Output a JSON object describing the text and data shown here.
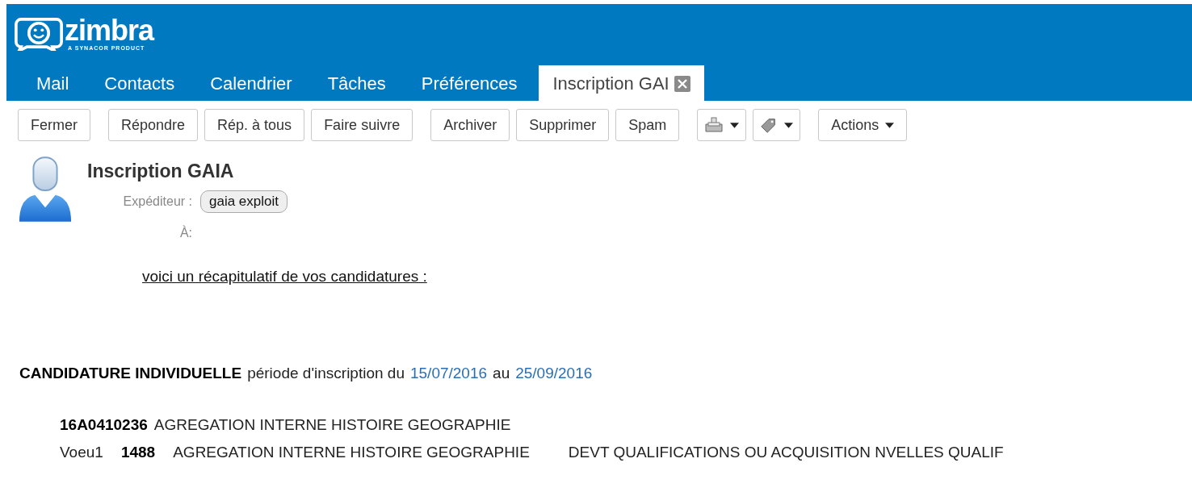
{
  "logo": {
    "name": "zimbra",
    "tagline": "A SYNACOR PRODUCT"
  },
  "tabs": [
    {
      "label": "Mail",
      "selected": false,
      "closable": false
    },
    {
      "label": "Contacts",
      "selected": false,
      "closable": false
    },
    {
      "label": "Calendrier",
      "selected": false,
      "closable": false
    },
    {
      "label": "Tâches",
      "selected": false,
      "closable": false
    },
    {
      "label": "Préférences",
      "selected": false,
      "closable": false
    },
    {
      "label": "Inscription GAI",
      "selected": true,
      "closable": true
    }
  ],
  "toolbar": [
    {
      "buttons": [
        {
          "kind": "text",
          "label": "Fermer"
        }
      ]
    },
    {
      "buttons": [
        {
          "kind": "text",
          "label": "Répondre"
        },
        {
          "kind": "text",
          "label": "Rép. à tous"
        },
        {
          "kind": "text",
          "label": "Faire suivre"
        }
      ]
    },
    {
      "buttons": [
        {
          "kind": "text",
          "label": "Archiver"
        },
        {
          "kind": "text",
          "label": "Supprimer"
        },
        {
          "kind": "text",
          "label": "Spam"
        }
      ]
    },
    {
      "buttons": [
        {
          "kind": "print"
        },
        {
          "kind": "tag"
        }
      ]
    },
    {
      "buttons": [
        {
          "kind": "menu",
          "label": "Actions"
        }
      ]
    }
  ],
  "message": {
    "subject": "Inscription GAIA",
    "sender_label": "Expéditeur :",
    "sender": "gaia exploit",
    "to_label": "À:",
    "intro": "voici un récapitulatif de vos candidatures :",
    "candidature": {
      "title": "CANDIDATURE INDIVIDUELLE",
      "period": "période d'inscription du",
      "start": "15/07/2016",
      "connector": "au",
      "end": "25/09/2016"
    },
    "exam": {
      "code": "16A0410236",
      "label": "AGREGATION INTERNE HISTOIRE GEOGRAPHIE"
    },
    "wish": {
      "name": "Voeu1",
      "number": "1488",
      "label": "AGREGATION INTERNE HISTOIRE GEOGRAPHIE",
      "reason": "DEVT QUALIFICATIONS OU ACQUISITION NVELLES QUALIF"
    }
  }
}
